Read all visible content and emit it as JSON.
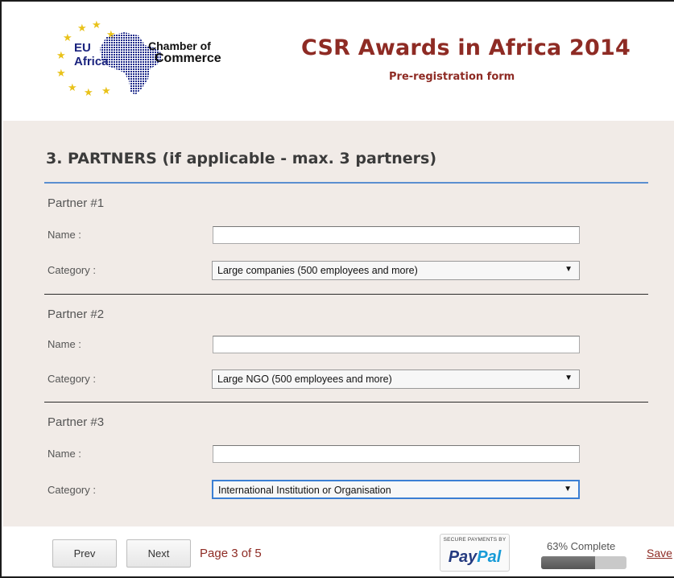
{
  "header": {
    "logo": {
      "line1": "EU",
      "line2": "Africa",
      "org_line1": "Chamber of",
      "org_line2": "Commerce"
    },
    "title": "CSR Awards in Africa 2014",
    "subtitle": "Pre-registration form"
  },
  "section": {
    "title": "3. PARTNERS (if applicable - max. 3 partners)"
  },
  "partners": [
    {
      "heading": "Partner #1",
      "name_label": "Name :",
      "name_value": "",
      "category_label": "Category :",
      "category_value": "Large companies (500 employees and more)"
    },
    {
      "heading": "Partner #2",
      "name_label": "Name :",
      "name_value": "",
      "category_label": "Category :",
      "category_value": "Large NGO (500 employees and more)"
    },
    {
      "heading": "Partner #3",
      "name_label": "Name :",
      "name_value": "",
      "category_label": "Category :",
      "category_value": "International Institution or Organisation"
    }
  ],
  "footer": {
    "prev_label": "Prev",
    "next_label": "Next",
    "page_info": "Page 3 of 5",
    "paypal_secure": "SECURE PAYMENTS BY",
    "paypal_brand_1": "Pay",
    "paypal_brand_2": "Pal",
    "progress_label": "63% Complete",
    "progress_value": 0.63,
    "save_label": "Save"
  },
  "colors": {
    "title": "#8e2b24",
    "section_rule": "#5b8fd0",
    "body_bg": "#f1ebe7"
  },
  "icons": [
    "select-arrow-icon",
    "star-icon"
  ]
}
